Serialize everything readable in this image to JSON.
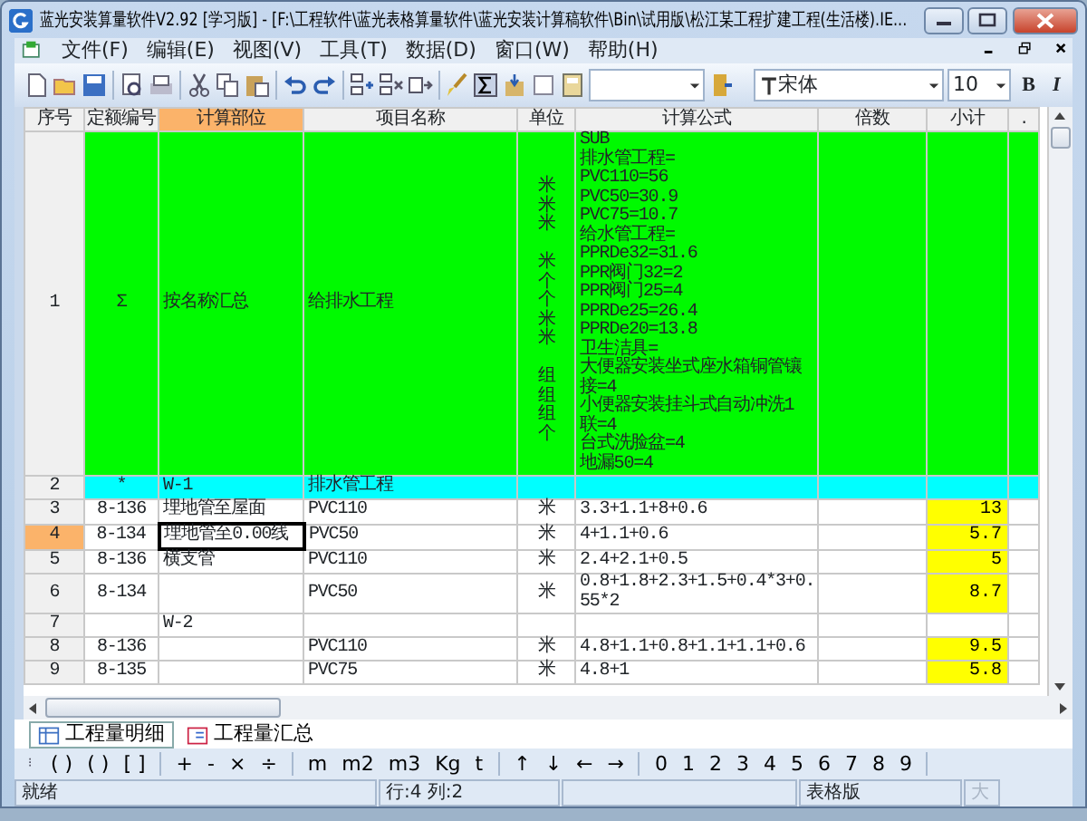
{
  "window": {
    "title": "蓝光安装算量软件V2.92 [学习版] - [F:\\工程软件\\蓝光表格算量软件\\蓝光安装计算稿软件\\Bin\\试用版\\松江某工程扩建工程(生活楼).IE..."
  },
  "menu": [
    "文件(F)",
    "编辑(E)",
    "视图(V)",
    "工具(T)",
    "数据(D)",
    "窗口(W)",
    "帮助(H)"
  ],
  "toolbar": {
    "font": "宋体",
    "size": "10",
    "bold": "B",
    "italic": "I"
  },
  "table": {
    "columns": [
      {
        "label": "序号",
        "selected": false
      },
      {
        "label": "定额编号",
        "selected": false
      },
      {
        "label": "计算部位",
        "selected": true
      },
      {
        "label": "项目名称",
        "selected": false
      },
      {
        "label": "单位",
        "selected": false
      },
      {
        "label": "计算公式",
        "selected": false
      },
      {
        "label": "倍数",
        "selected": false
      },
      {
        "label": "小计",
        "selected": false
      },
      {
        "label": ".",
        "selected": false
      }
    ],
    "rows": [
      {
        "number": "1",
        "kind": "summary",
        "selected": false,
        "part_active": false,
        "code": "Σ",
        "part": "按名称汇总",
        "name": "给排水工程",
        "unit_groups": [
          [
            "米",
            "米",
            "米"
          ],
          [
            "米",
            "个",
            "个",
            "米",
            "米"
          ],
          [
            "组",
            "组",
            "组",
            "个"
          ]
        ],
        "formula_lines": [
          "SUB",
          "排水管工程=",
          "PVC110=56",
          "PVC50=30.9",
          "PVC75=10.7",
          "给水管工程=",
          "PPRDe32=31.6",
          "PPR阀门32=2",
          "PPR阀门25=4",
          "PPRDe25=26.4",
          "PPRDe20=13.8",
          "卫生洁具=",
          "大便器安装坐式座水箱铜管镶",
          "接=4",
          "小便器安装挂斗式自动冲洗1",
          "联=4",
          "台式洗脸盆=4",
          "地漏50=4"
        ]
      },
      {
        "number": "2",
        "kind": "group",
        "selected": false,
        "part_active": false,
        "code": "*",
        "part": "W-1",
        "name": "排水管工程"
      },
      {
        "number": "3",
        "kind": "item",
        "selected": false,
        "part_active": false,
        "code": "8-136",
        "part": "埋地管至屋面",
        "name": "PVC110",
        "unit": "米",
        "formula_lines": [
          "3.3+1.1+8+0.6"
        ],
        "subtotal": "13"
      },
      {
        "number": "4",
        "kind": "item",
        "selected": true,
        "part_active": true,
        "code": "8-134",
        "part": "埋地管至0.00线",
        "name": "PVC50",
        "unit": "米",
        "formula_lines": [
          "4+1.1+0.6"
        ],
        "subtotal": "5.7"
      },
      {
        "number": "5",
        "kind": "item",
        "selected": false,
        "part_active": false,
        "code": "8-136",
        "part": "横支管",
        "name": "PVC110",
        "unit": "米",
        "formula_lines": [
          "2.4+2.1+0.5"
        ],
        "subtotal": "5"
      },
      {
        "number": "6",
        "kind": "item",
        "selected": false,
        "part_active": false,
        "code": "8-134",
        "name": "PVC50",
        "unit": "米",
        "formula_lines": [
          "0.8+1.8+2.3+1.5+0.4*3+0.",
          "55*2"
        ],
        "subtotal": "8.7"
      },
      {
        "number": "7",
        "kind": "item",
        "selected": false,
        "part_active": false,
        "part": "W-2"
      },
      {
        "number": "8",
        "kind": "item",
        "selected": false,
        "part_active": false,
        "code": "8-136",
        "name": "PVC110",
        "unit": "米",
        "formula_lines": [
          "4.8+1.1+0.8+1.1+1.1+0.6"
        ],
        "subtotal": "9.5"
      },
      {
        "number": "9",
        "kind": "item",
        "selected": false,
        "part_active": false,
        "code": "8-135",
        "name": "PVC75",
        "unit": "米",
        "formula_lines": [
          "4.8+1"
        ],
        "subtotal": "5.8"
      }
    ]
  },
  "sheet_tabs": [
    {
      "label": "工程量明细",
      "selected": true
    },
    {
      "label": "工程量汇总",
      "selected": false
    }
  ],
  "keys": [
    [
      "( )",
      "( )",
      "[ ]"
    ],
    [
      "+",
      "-",
      "×",
      "÷"
    ],
    [
      "m",
      "m2",
      "m3",
      "Kg",
      "t"
    ],
    [
      "↑",
      "↓",
      "←",
      "→"
    ],
    [
      "0",
      "1",
      "2",
      "3",
      "4",
      "5",
      "6",
      "7",
      "8",
      "9"
    ]
  ],
  "status_bar": [
    {
      "text": "就绪",
      "disabled": false
    },
    {
      "text": "行:4 列:2",
      "disabled": false
    },
    {
      "text": "表格版",
      "disabled": false
    },
    {
      "text": "大",
      "disabled": true
    }
  ]
}
